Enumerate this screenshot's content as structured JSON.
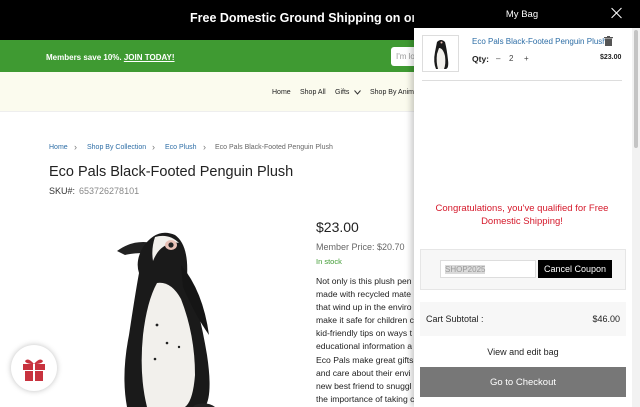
{
  "promo": {
    "text": "Free Domestic Ground Shipping on orders ove"
  },
  "members": {
    "text": "Members save 10%.",
    "link": "JOIN TODAY!"
  },
  "search": {
    "placeholder": "I'm lo"
  },
  "nav": {
    "items": [
      "Home",
      "Shop All",
      "Gifts",
      "Shop By Anima"
    ]
  },
  "breadcrumb": [
    "Home",
    "Shop By Collection",
    "Eco Plush",
    "Eco Pals Black-Footed Penguin Plush"
  ],
  "product": {
    "title": "Eco Pals Black-Footed Penguin Plush",
    "sku_label": "SKU#:",
    "sku": "653726278101",
    "price": "$23.00",
    "member_price": "Member Price: $20.70",
    "stock": "In stock",
    "description_lines": [
      "Not only is this plush pen",
      "made with recycled mate",
      "that wind up in the enviro",
      "make it safe for children c",
      "kid-friendly tips on ways t",
      "educational information a",
      "Eco Pals make great gifts",
      "and care about their envi",
      "new best friend to snuggl",
      "the importance of taking c"
    ]
  },
  "cart": {
    "title": "My Bag",
    "item": {
      "name": "Eco Pals Black-Footed Penguin Plush",
      "qty_label": "Qty:",
      "qty_minus": "–",
      "qty": "2",
      "qty_plus": "+",
      "price": "$23.00"
    },
    "congrats": "Congratulations, you've qualified for Free Domestic Shipping!",
    "coupon": {
      "code": "SHOP2025",
      "button": "Cancel Coupon"
    },
    "subtotal": {
      "label": "Cart Subtotal :",
      "value": "$46.00"
    },
    "view_bag": "View and edit bag",
    "checkout": "Go to Checkout"
  },
  "icons": {
    "close": "close-icon",
    "trash": "trash-icon",
    "gift": "gift-icon",
    "chevron": "chevron-down-icon"
  },
  "colors": {
    "promo_bg": "#000000",
    "members_bg": "#3f9a32",
    "link": "#2e6ea6",
    "congrats": "#d5182a",
    "checkout_bg": "#777777",
    "gift": "#c8323e"
  }
}
